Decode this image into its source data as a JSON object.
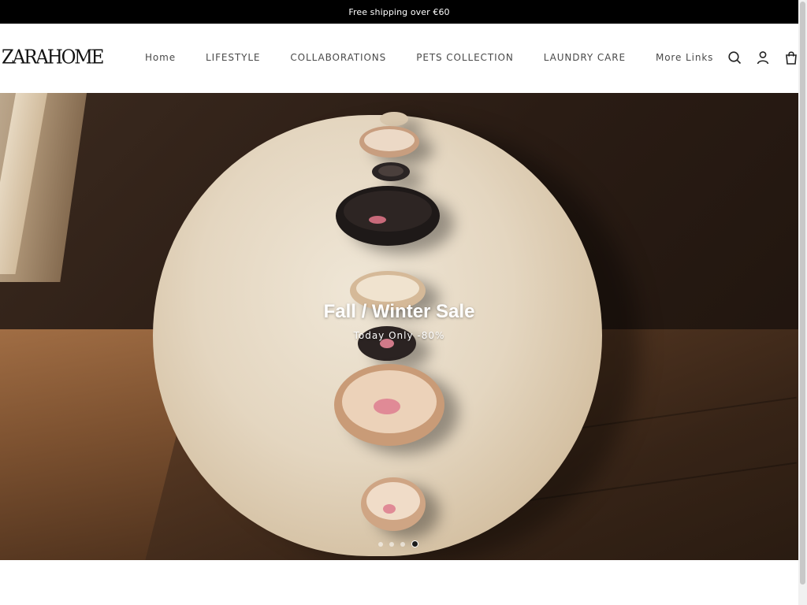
{
  "announcement": {
    "text": "Free shipping over €60"
  },
  "header": {
    "logo": "ZARAHOME",
    "nav": [
      {
        "label": "Home"
      },
      {
        "label": "LIFESTYLE"
      },
      {
        "label": "COLLABORATIONS"
      },
      {
        "label": "PETS COLLECTION"
      },
      {
        "label": "LAUNDRY CARE"
      },
      {
        "label": "More Links"
      }
    ],
    "icons": [
      "search-icon",
      "account-icon",
      "cart-icon"
    ]
  },
  "hero": {
    "title": "Fall / Winter Sale",
    "subtitle": "Today Only -80%",
    "slides_total": 4,
    "active_slide": 4
  },
  "colors": {
    "announcement_bg": "#000000",
    "nav_text": "#4a4a4a",
    "hero_text": "#ffffff"
  }
}
